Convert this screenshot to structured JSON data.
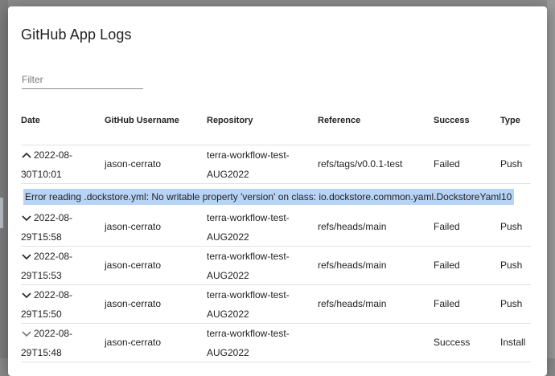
{
  "dialog": {
    "title": "GitHub App Logs"
  },
  "filter": {
    "placeholder": "Filter",
    "value": ""
  },
  "table": {
    "headers": {
      "date": "Date",
      "username": "GitHub Username",
      "repository": "Repository",
      "reference": "Reference",
      "success": "Success",
      "type": "Type"
    },
    "rows": [
      {
        "expanded": true,
        "chevron_icon": "chevron-up-icon",
        "date_line1": "2022-08-",
        "date_line2": "30T10:01",
        "username": "jason-cerrato",
        "repo_line1": "terra-workflow-test-",
        "repo_line2": "AUG2022",
        "reference": "refs/tags/v0.0.1-test",
        "success": "Failed",
        "type": "Push",
        "error": "Error reading .dockstore.yml: No writable property 'version' on class: io.dockstore.common.yaml.DockstoreYaml10"
      },
      {
        "expanded": false,
        "chevron_icon": "chevron-down-icon",
        "date_line1": "2022-08-",
        "date_line2": "29T15:58",
        "username": "jason-cerrato",
        "repo_line1": "terra-workflow-test-",
        "repo_line2": "AUG2022",
        "reference": "refs/heads/main",
        "success": "Failed",
        "type": "Push"
      },
      {
        "expanded": false,
        "chevron_icon": "chevron-down-icon",
        "date_line1": "2022-08-",
        "date_line2": "29T15:53",
        "username": "jason-cerrato",
        "repo_line1": "terra-workflow-test-",
        "repo_line2": "AUG2022",
        "reference": "refs/heads/main",
        "success": "Failed",
        "type": "Push"
      },
      {
        "expanded": false,
        "chevron_icon": "chevron-down-icon",
        "date_line1": "2022-08-",
        "date_line2": "29T15:50",
        "username": "jason-cerrato",
        "repo_line1": "terra-workflow-test-",
        "repo_line2": "AUG2022",
        "reference": "refs/heads/main",
        "success": "Failed",
        "type": "Push"
      },
      {
        "expanded": false,
        "chevron_icon": "chevron-down-icon",
        "date_line1": "2022-08-",
        "date_line2": "29T15:48",
        "username": "jason-cerrato",
        "repo_line1": "terra-workflow-test-",
        "repo_line2": "AUG2022",
        "reference": "",
        "success": "Success",
        "type": "Install"
      }
    ]
  }
}
